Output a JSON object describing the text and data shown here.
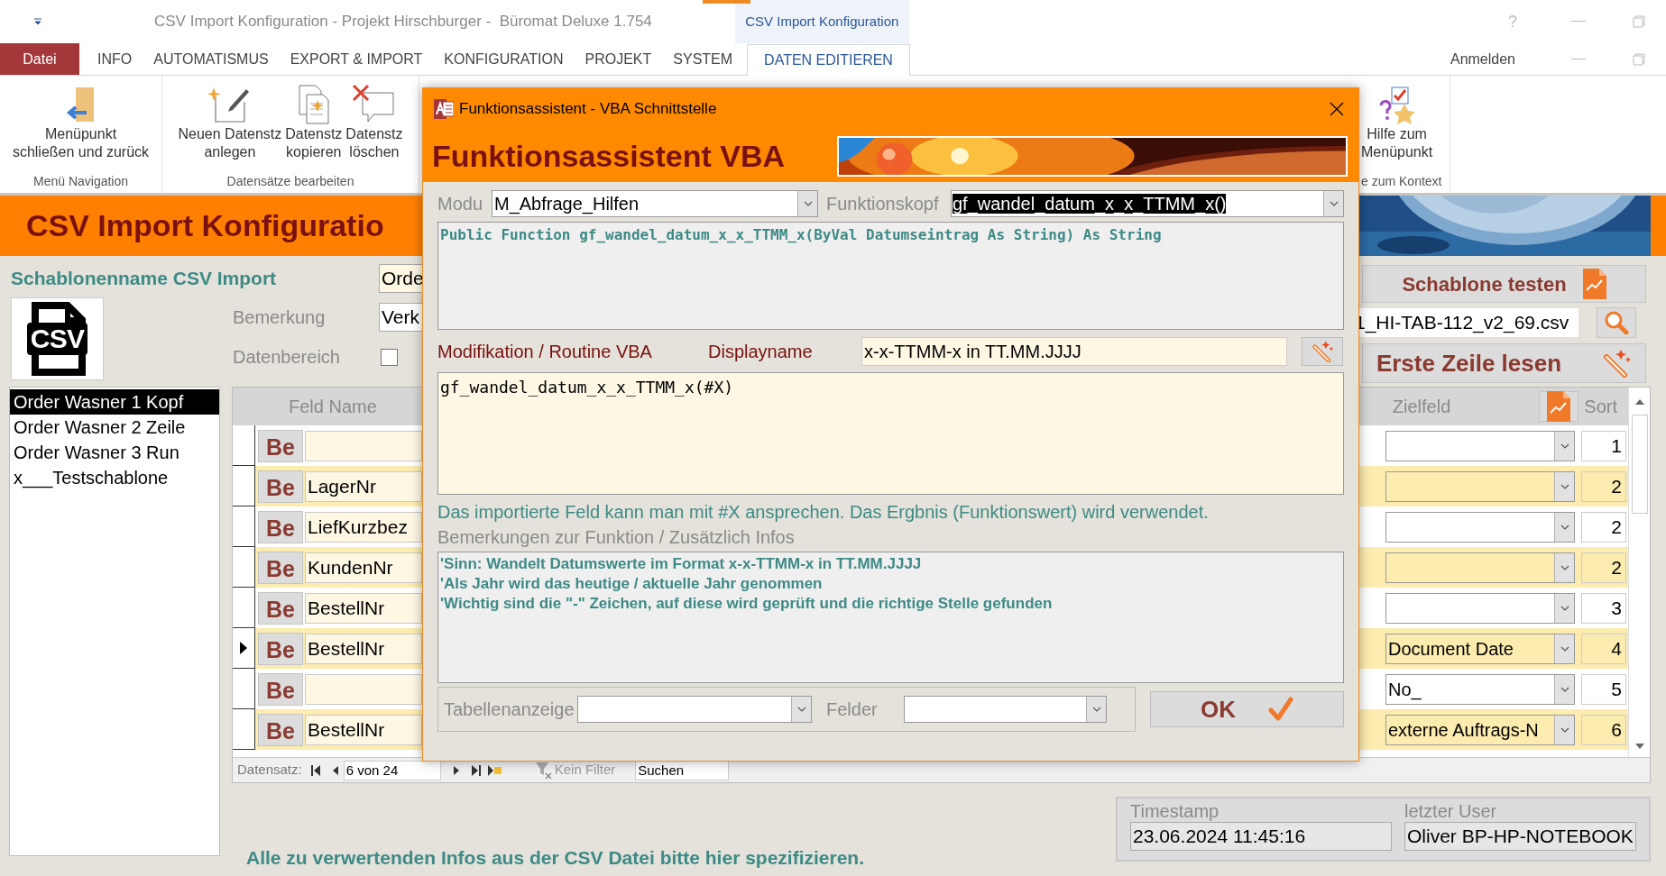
{
  "title_bar": {
    "title": "CSV Import Konfiguration - Projekt Hirschburger -  Büromat Deluxe 1.754",
    "context_tab": "CSV Import Konfiguration",
    "help": "?"
  },
  "ribbon_tabs": [
    {
      "label": "Datei",
      "kind": "file",
      "selected": false
    },
    {
      "label": "INFO",
      "kind": "tab",
      "selected": false
    },
    {
      "label": "AUTOMATISMUS",
      "kind": "tab",
      "selected": false
    },
    {
      "label": "EXPORT & IMPORT",
      "kind": "tab",
      "selected": false
    },
    {
      "label": "KONFIGURATION",
      "kind": "tab",
      "selected": false
    },
    {
      "label": "PROJEKT",
      "kind": "tab",
      "selected": false
    },
    {
      "label": "SYSTEM",
      "kind": "tab",
      "selected": false
    },
    {
      "label": "DATEN EDITIEREN",
      "kind": "tab",
      "selected": true
    }
  ],
  "account": "Anmelden",
  "ribbon_groups": [
    {
      "label": "Menü Navigation",
      "buttons": [
        {
          "kind": "exit",
          "lines": [
            "Menüpunkt",
            "schließen und zurück"
          ]
        }
      ]
    },
    {
      "label": "Datensätze bearbeiten",
      "buttons": [
        {
          "kind": "new",
          "lines": [
            "Neuen Datenstz",
            "anlegen"
          ]
        },
        {
          "kind": "copy",
          "lines": [
            "Datenstz",
            "kopieren"
          ]
        },
        {
          "kind": "delete",
          "lines": [
            "Datenstz",
            "löschen"
          ]
        }
      ]
    },
    {
      "label": "e zum Kontext",
      "buttons": [
        {
          "kind": "help",
          "lines": [
            "Hilfe zum",
            "Menüpunkt"
          ]
        }
      ]
    }
  ],
  "form": {
    "header": "CSV Import Konfiguratio",
    "template_label": "Schablonenname CSV Import",
    "template_name": "Orde",
    "csv_icon_text": "CSV",
    "remark_label": "Bemerkung",
    "remark": "Verk",
    "range_label": "Datenbereich",
    "range_checked": false,
    "templates": [
      {
        "label": "Order Wasner 1 Kopf",
        "selected": true
      },
      {
        "label": "Order Wasner 2 Zeile",
        "selected": false
      },
      {
        "label": "Order Wasner 3 Run",
        "selected": false
      },
      {
        "label": "x___Testschablone",
        "selected": false
      }
    ],
    "test_button": "Schablone testen",
    "file": "1_HI-TAB-112_v2_69.csv",
    "read_button": "Erste Zeile lesen",
    "grid": {
      "columns": [
        "Feld Name",
        "Zielfeld",
        "Sort"
      ],
      "rows": [
        {
          "button": "Be",
          "field": "",
          "target": "",
          "sort": "1",
          "current": false
        },
        {
          "button": "Be",
          "field": "LagerNr",
          "target": "",
          "sort": "2",
          "current": false
        },
        {
          "button": "Be",
          "field": "LiefKurzbez",
          "target": "",
          "sort": "2",
          "current": false
        },
        {
          "button": "Be",
          "field": "KundenNr",
          "target": "",
          "sort": "2",
          "current": false
        },
        {
          "button": "Be",
          "field": "BestellNr",
          "target": "",
          "sort": "3",
          "current": false
        },
        {
          "button": "Be",
          "field": "BestellNr",
          "target": "Document Date",
          "sort": "4",
          "current": true
        },
        {
          "button": "Be",
          "field": "",
          "target": "No_",
          "sort": "5",
          "current": false
        },
        {
          "button": "Be",
          "field": "BestellNr",
          "target": "externe Auftrags-N",
          "sort": "6",
          "current": false
        }
      ],
      "nav": {
        "label": "Datensatz:",
        "position": "6 von 24",
        "filter": "Kein Filter",
        "search": "Suchen"
      }
    },
    "hint": "Alle zu verwertenden Infos aus der CSV Datei bitte hier spezifizieren.",
    "timestamp_label": "Timestamp",
    "timestamp": "23.06.2024 11:45:16",
    "user_label": "letzter User",
    "user": "Oliver BP-HP-NOTEBOOK"
  },
  "dialog": {
    "title": "Funktionsassistent - VBA Schnittstelle",
    "heading": "Funktionsassistent VBA",
    "module_label": "Modu",
    "module": "M_Abfrage_Hilfen",
    "header_label": "Funktionskopf",
    "header": "gf_wandel_datum_x_x_TTMM_x()",
    "header_text_selected": true,
    "signature": "Public Function gf_wandel_datum_x_x_TTMM_x(ByVal Datumseintrag As String) As String",
    "mod_label": "Modifikation / Routine VBA",
    "display_label": "Displayname",
    "display_name": "x-x-TTMM-x in TT.MM.JJJJ",
    "code": "gf_wandel_datum_x_x_TTMM_x(#X)",
    "hint": "Das importierte Feld kann man mit #X ansprechen. Das Ergbnis (Funktionswert) wird verwendet.",
    "notes_label": "Bemerkungen zur Funktion / Zusätzlich Infos",
    "notes": [
      "'Sinn: Wandelt Datumswerte im Format x-x-TTMM-x in TT.MM.JJJJ",
      "'Als Jahr wird das heutige / aktuelle Jahr genommen",
      "'Wichtig sind die \"-\" Zeichen, auf diese wird geprüft und die richtige Stelle gefunden"
    ],
    "table_label": "Tabellenanzeige",
    "fields_label": "Felder",
    "ok": "OK"
  }
}
